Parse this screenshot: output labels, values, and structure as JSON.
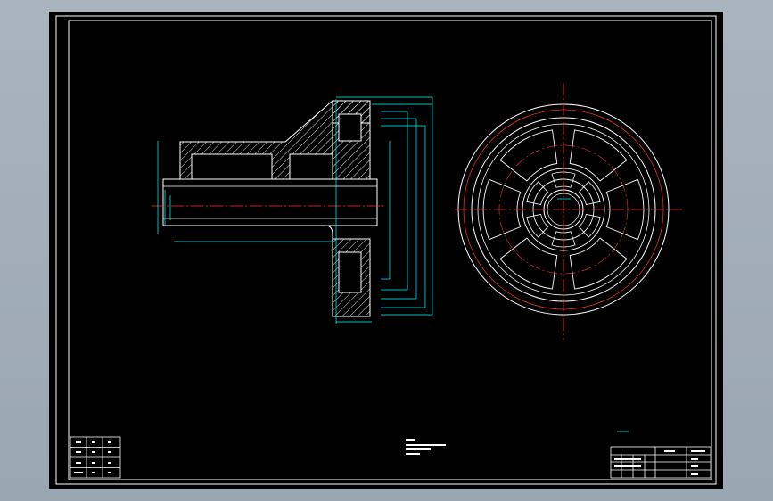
{
  "viewport": {
    "background": "#000000"
  },
  "colors": {
    "outline": "#ffffff",
    "dimension": "#00ffff",
    "centerline": "#ff3333",
    "hatch": "#ffffff",
    "note": "#ffffff",
    "desktop": "#a3aeba"
  },
  "drawing": {
    "title_block": {
      "rows": [
        [
          "",
          "",
          ""
        ],
        [
          "",
          "",
          ""
        ],
        [
          "",
          "",
          ""
        ],
        [
          "",
          "",
          ""
        ]
      ]
    },
    "notes": {
      "lines": []
    }
  }
}
